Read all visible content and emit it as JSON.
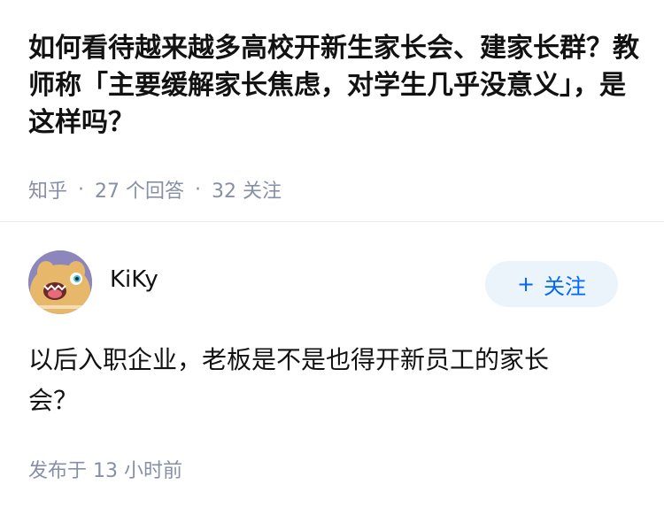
{
  "question": {
    "title": "如何看待越来越多高校开新生家长会、建家长群？教师称「主要缓解家长焦虑，对学生几乎没意义」，是这样吗？",
    "source": "知乎",
    "separator": "·",
    "answers": "27 个回答",
    "followers": "32 关注"
  },
  "author": {
    "name": "KiKy",
    "follow_plus": "+",
    "follow_label": "关注"
  },
  "answer": {
    "content": "以后入职企业，老板是不是也得开新员工的家长会？",
    "published": "发布于 13 小时前"
  }
}
